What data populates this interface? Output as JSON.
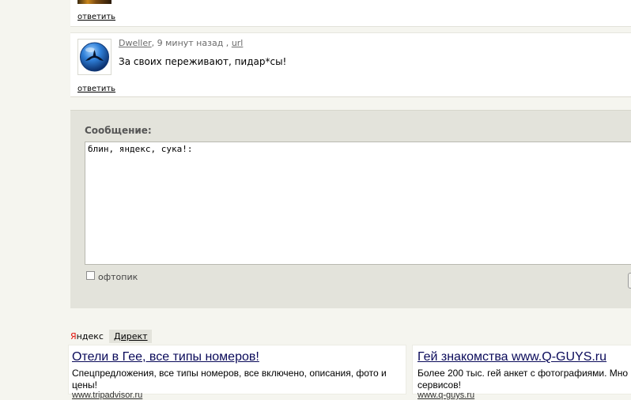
{
  "top_comment": {
    "reply_label": "ответить"
  },
  "comment": {
    "author": "Dweller",
    "time": ", 9 минут назад , ",
    "url_label": "url",
    "text": "За своих переживают, пидар*сы!",
    "reply_label": "ответить"
  },
  "form": {
    "label": "Сообщение:",
    "message": "блин, яндекс, сука!:",
    "offtopic_label": "офтопик"
  },
  "ads": {
    "brand_first": "Я",
    "brand_rest": "ндекс",
    "direct_label": "Директ",
    "items": [
      {
        "title": "Отели в Гее, все типы номеров!",
        "desc": "Спецпредложения, все типы номеров, все включено, описания, фото и цены!",
        "url": "www.tripadvisor.ru"
      },
      {
        "title": "Гей знакомства www.Q-GUYS.ru",
        "desc": "Более 200 тыс. гей анкет с фотографиями. Мно сервисов!",
        "url": "www.q-guys.ru"
      }
    ]
  }
}
